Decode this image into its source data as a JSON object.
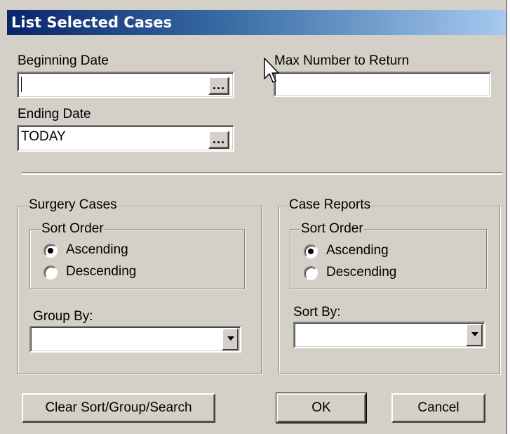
{
  "window": {
    "title": "List Selected Cases"
  },
  "dates": {
    "beginning_label": "Beginning Date",
    "beginning_value": "",
    "ending_label": "Ending Date",
    "ending_value": "TODAY",
    "browse_label": "..."
  },
  "max_return": {
    "label": "Max Number to Return",
    "value": ""
  },
  "surgery_cases": {
    "title": "Surgery Cases",
    "sort_order_title": "Sort Order",
    "ascending_label": "Ascending",
    "descending_label": "Descending",
    "selected": "Ascending",
    "group_by_label": "Group By:",
    "group_by_value": ""
  },
  "case_reports": {
    "title": "Case Reports",
    "sort_order_title": "Sort Order",
    "ascending_label": "Ascending",
    "descending_label": "Descending",
    "selected": "Ascending",
    "sort_by_label": "Sort By:",
    "sort_by_value": ""
  },
  "buttons": {
    "clear_label": "Clear Sort/Group/Search",
    "ok_label": "OK",
    "cancel_label": "Cancel"
  },
  "colors": {
    "dialog_bg": "#d4d0c8",
    "title_start": "#0a246a",
    "title_end": "#a6caf0"
  },
  "icons": {
    "cursor": "mouse-pointer-icon",
    "dropdown": "chevron-down-icon"
  }
}
